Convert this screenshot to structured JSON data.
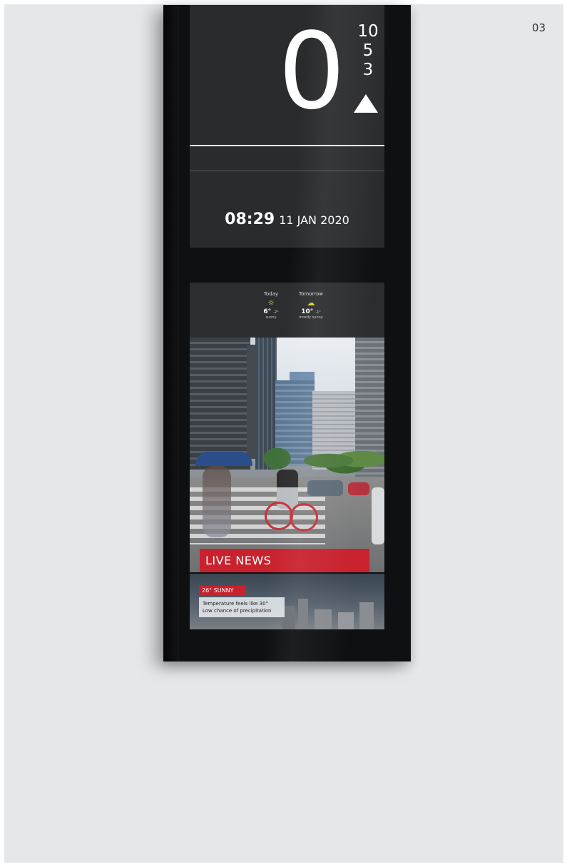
{
  "page": {
    "number": "03",
    "background": "#e6e7e9"
  },
  "display": {
    "floor": {
      "current": "0",
      "queue": [
        "10",
        "5",
        "3"
      ],
      "direction": "up"
    },
    "clock": {
      "time": "08:29",
      "date": "11 JAN 2020"
    },
    "weather": {
      "today": {
        "label": "Today",
        "icon": "sun-icon",
        "temp": "6°",
        "low": "-2°",
        "desc": "sunny"
      },
      "tomorrow": {
        "label": "Tomorrow",
        "icon": "partly-cloudy-icon",
        "temp": "10°",
        "low": "-1°",
        "desc": "mostly sunny"
      }
    },
    "news": {
      "banner": "LIVE NEWS",
      "accent": "#c8222e"
    },
    "ticker": {
      "badge": "26° SUNNY",
      "lines": [
        "Temperature feels like 30°",
        "Low chance of precipitation"
      ]
    }
  }
}
